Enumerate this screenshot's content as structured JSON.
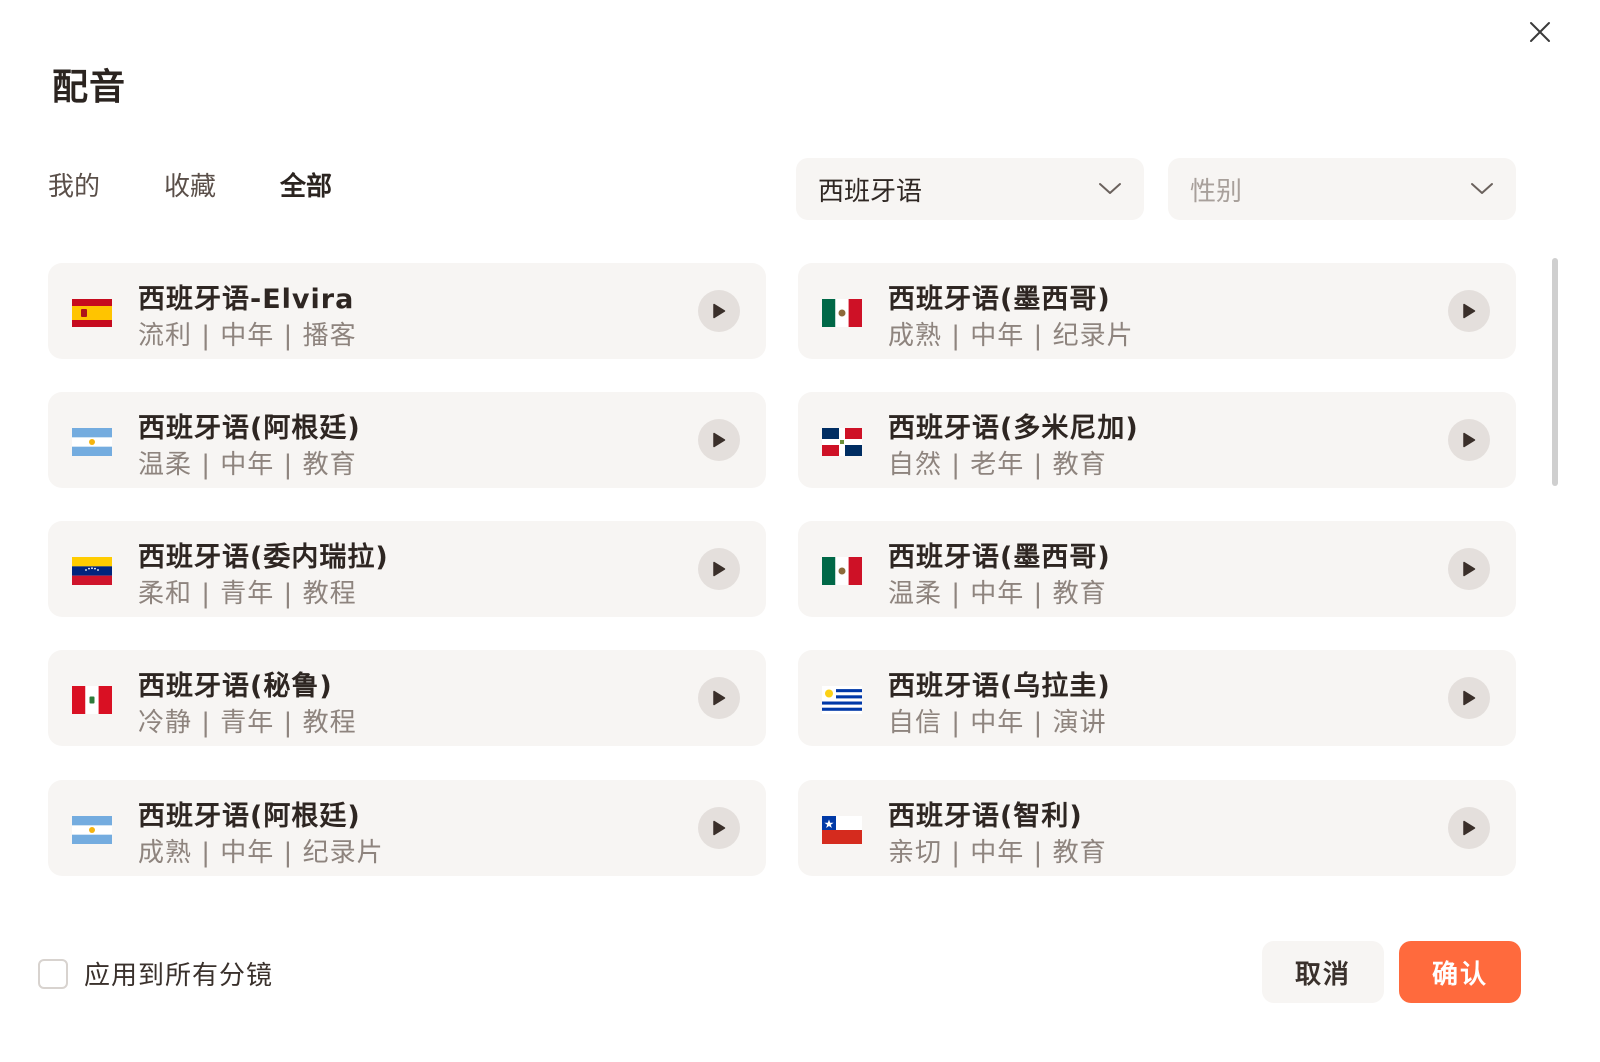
{
  "dialog": {
    "title": "配音",
    "close_icon": "close-icon"
  },
  "tabs": [
    {
      "label": "我的",
      "active": false
    },
    {
      "label": "收藏",
      "active": false
    },
    {
      "label": "全部",
      "active": true
    }
  ],
  "filters": {
    "language": {
      "value": "西班牙语",
      "icon": "chevron-down-icon"
    },
    "gender": {
      "placeholder": "性别",
      "icon": "chevron-down-icon"
    }
  },
  "voices": [
    {
      "name": "西班牙语-Elvira",
      "tags": "流利 | 中年 | 播客",
      "flag": "spain-flag"
    },
    {
      "name": "西班牙语(墨西哥)",
      "tags": "成熟 | 中年 | 纪录片",
      "flag": "mexico-flag"
    },
    {
      "name": "西班牙语(阿根廷)",
      "tags": "温柔 | 中年 | 教育",
      "flag": "argentina-flag"
    },
    {
      "name": "西班牙语(多米尼加)",
      "tags": "自然 | 老年 | 教育",
      "flag": "dominican-republic-flag"
    },
    {
      "name": "西班牙语(委内瑞拉)",
      "tags": "柔和 | 青年 | 教程",
      "flag": "venezuela-flag"
    },
    {
      "name": "西班牙语(墨西哥)",
      "tags": "温柔 | 中年 | 教育",
      "flag": "mexico-flag"
    },
    {
      "name": "西班牙语(秘鲁)",
      "tags": "冷静 | 青年 | 教程",
      "flag": "peru-flag"
    },
    {
      "name": "西班牙语(乌拉圭)",
      "tags": "自信 | 中年 | 演讲",
      "flag": "uruguay-flag"
    },
    {
      "name": "西班牙语(阿根廷)",
      "tags": "成熟 | 中年 | 纪录片",
      "flag": "argentina-flag"
    },
    {
      "name": "西班牙语(智利)",
      "tags": "亲切 | 中年 | 教育",
      "flag": "chile-flag"
    }
  ],
  "footer": {
    "apply_all_label": "应用到所有分镜",
    "apply_all_checked": false,
    "cancel_label": "取消",
    "confirm_label": "确认"
  },
  "colors": {
    "accent": "#ff6a3d",
    "card_bg": "#f7f5f3"
  }
}
